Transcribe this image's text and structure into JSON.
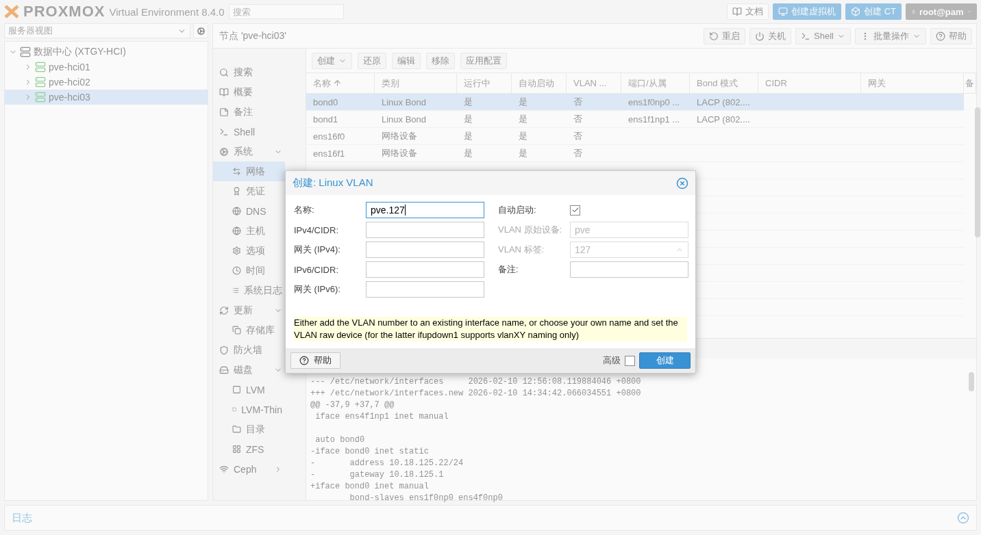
{
  "header": {
    "logo": "PROXMOX",
    "product": "Virtual Environment 8.4.0",
    "search": {
      "placeholder": "搜索"
    },
    "buttons": [
      {
        "label": "文档",
        "kind": "plain"
      },
      {
        "label": "创建虚拟机",
        "kind": "primary"
      },
      {
        "label": "创建 CT",
        "kind": "primary"
      }
    ],
    "user": "root@pam"
  },
  "sidebar": {
    "view": "服务器视图",
    "tree": [
      {
        "label": "数据中心 (XTGY-HCI)",
        "expanded": true,
        "selected": false,
        "children": [
          {
            "label": "pve-hci01",
            "expanded": false,
            "selected": false
          },
          {
            "label": "pve-hci02",
            "expanded": false,
            "selected": false
          },
          {
            "label": "pve-hci03",
            "expanded": false,
            "selected": true
          }
        ]
      }
    ]
  },
  "node": {
    "title": "节点 'pve-hci03'",
    "buttons": [
      {
        "label": "重启",
        "kind": "plain"
      },
      {
        "label": "关机",
        "kind": "plain"
      },
      {
        "label": "Shell",
        "kind": "split"
      },
      {
        "label": "批量操作",
        "kind": "menu"
      },
      {
        "label": "帮助",
        "kind": "plain"
      }
    ]
  },
  "nav": [
    {
      "label": "搜索",
      "selected": false
    },
    {
      "label": "概要",
      "selected": false
    },
    {
      "label": "备注",
      "selected": false
    },
    {
      "label": "Shell",
      "selected": false
    },
    {
      "label": "系统",
      "selected": false,
      "expanded": true,
      "children": [
        {
          "label": "网络",
          "selected": true
        },
        {
          "label": "凭证",
          "selected": false
        },
        {
          "label": "DNS",
          "selected": false
        },
        {
          "label": "主机",
          "selected": false
        },
        {
          "label": "选项",
          "selected": false
        },
        {
          "label": "时间",
          "selected": false
        },
        {
          "label": "系统日志",
          "selected": false
        }
      ]
    },
    {
      "label": "更新",
      "selected": false,
      "expanded": true,
      "children": [
        {
          "label": "存储库",
          "selected": false
        }
      ]
    },
    {
      "label": "防火墙",
      "selected": false
    },
    {
      "label": "磁盘",
      "selected": false,
      "expanded": true,
      "children": [
        {
          "label": "LVM",
          "selected": false
        },
        {
          "label": "LVM-Thin",
          "selected": false
        },
        {
          "label": "目录",
          "selected": false
        },
        {
          "label": "ZFS",
          "selected": false
        }
      ]
    },
    {
      "label": "Ceph",
      "selected": false,
      "expanded": false
    }
  ],
  "toolbar": [
    {
      "label": "创建",
      "kind": "menu"
    },
    {
      "label": "还原",
      "kind": "plain"
    },
    {
      "label": "编辑",
      "kind": "plain"
    },
    {
      "label": "移除",
      "kind": "plain"
    },
    {
      "label": "应用配置",
      "kind": "plain"
    }
  ],
  "table": {
    "columns": [
      "名称",
      "类别",
      "运行中",
      "自动启动",
      "VLAN ...",
      "端口/从属",
      "Bond 模式",
      "CIDR",
      "网关",
      "备"
    ],
    "rows": [
      {
        "selected": true,
        "cells": [
          "bond0",
          "Linux Bond",
          "是",
          "是",
          "否",
          "ens1f0np0 ...",
          "LACP (802....",
          "",
          ""
        ]
      },
      {
        "selected": false,
        "cells": [
          "bond1",
          "Linux Bond",
          "是",
          "是",
          "否",
          "ens1f1np1 ...",
          "LACP (802....",
          "",
          ""
        ]
      },
      {
        "selected": false,
        "cells": [
          "ens16f0",
          "网络设备",
          "是",
          "是",
          "否",
          "",
          "",
          "",
          ""
        ]
      },
      {
        "selected": false,
        "cells": [
          "ens16f1",
          "网络设备",
          "是",
          "是",
          "否",
          "",
          "",
          "",
          ""
        ]
      }
    ]
  },
  "diff": "--- /etc/network/interfaces     2026-02-10 12:56:08.119884046 +0800\n+++ /etc/network/interfaces.new 2026-02-10 14:34:42.066034551 +0800\n@@ -37,9 +37,7 @@\n iface ens4f1np1 inet manual\n\n auto bond0\n-iface bond0 inet static\n-       address 10.18.125.22/24\n-       gateway 10.18.125.1\n+iface bond0 inet manual\n        bond-slaves ens1f0np0 ens4f0np0",
  "log": {
    "title": "日志"
  },
  "dialog": {
    "title": "创建: Linux VLAN",
    "left": [
      {
        "label": "名称:",
        "kind": "text",
        "value": "pve.127",
        "focused": true,
        "disabled": false
      },
      {
        "label": "IPv4/CIDR:",
        "kind": "text",
        "focused": false,
        "disabled": false
      },
      {
        "label": "网关 (IPv4):",
        "kind": "text",
        "focused": false,
        "disabled": false
      },
      {
        "label": "IPv6/CIDR:",
        "kind": "text",
        "focused": false,
        "disabled": false
      },
      {
        "label": "网关 (IPv6):",
        "kind": "text",
        "focused": false,
        "disabled": false
      }
    ],
    "right": [
      {
        "label": "自动启动:",
        "kind": "checkbox",
        "checked": true,
        "disabled": false
      },
      {
        "label": "VLAN 原始设备:",
        "kind": "text",
        "value": "pve",
        "focused": false,
        "disabled": true
      },
      {
        "label": "VLAN 标签:",
        "kind": "spinner",
        "value": "127",
        "focused": false,
        "disabled": true
      },
      {
        "label": "备注:",
        "kind": "text",
        "focused": false,
        "disabled": false
      }
    ],
    "hint": "Either add the VLAN number to an existing interface name, or choose your own name and set the VLAN raw device (for the latter ifupdown1 supports vlanXY naming only)",
    "help": "帮助",
    "advanced": {
      "label": "高级",
      "checked": false
    },
    "submit": "创建"
  }
}
